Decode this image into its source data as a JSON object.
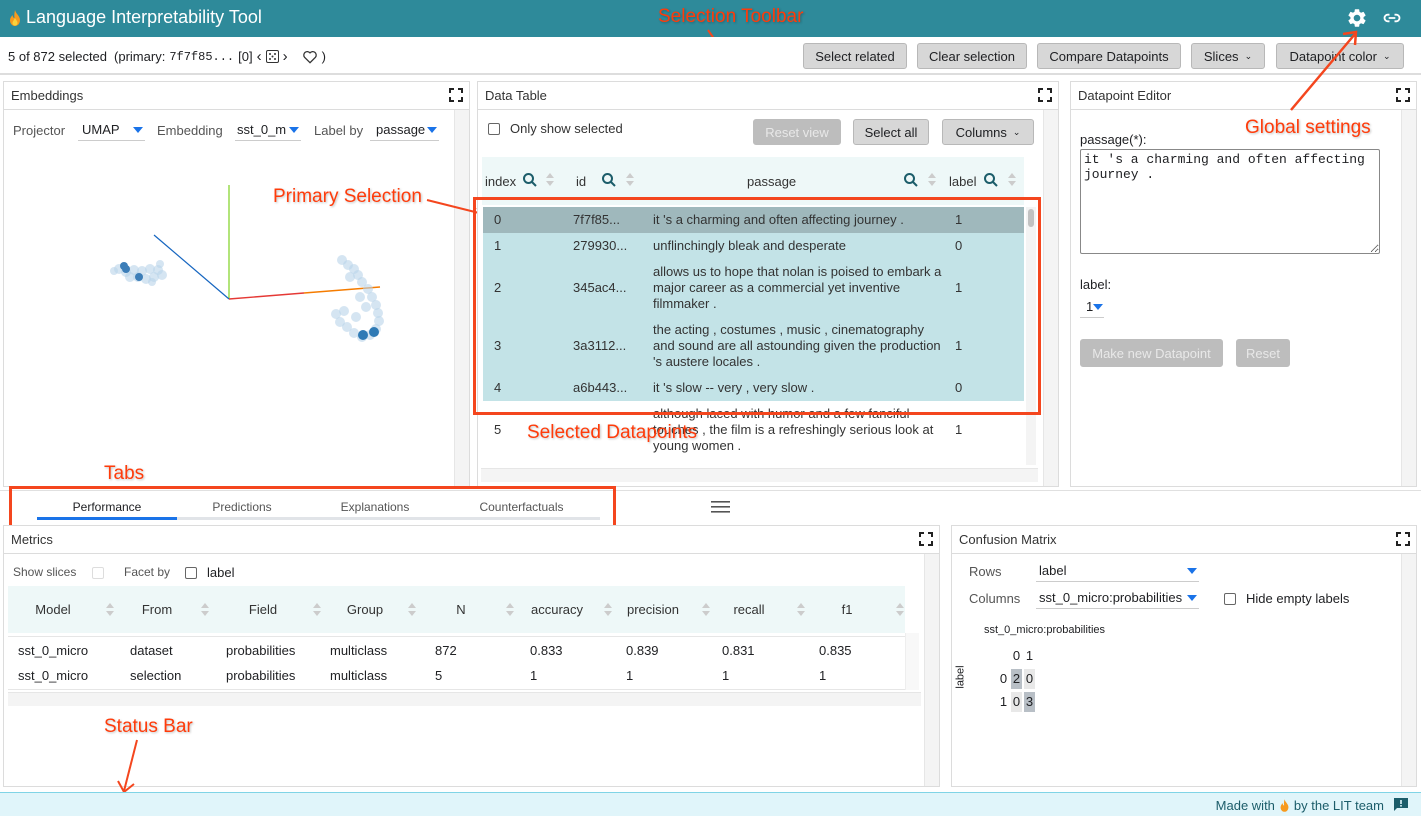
{
  "app": {
    "title": "Language Interpretability Tool",
    "icons": {
      "logo": "flame-icon",
      "settings": "gear-icon",
      "share": "link-icon"
    },
    "theme": {
      "header_bg": "#2e8a9a",
      "accent": "#1a73e8",
      "selected_row": "#c3e3e7",
      "primary_row": "#9fb8bc",
      "annotation": "#ff3b0a"
    }
  },
  "selection_toolbar": {
    "status_prefix": "5 of 872 selected",
    "primary_label": "(primary:",
    "primary_id": "7f7f85...",
    "primary_index": "[0]",
    "prev": "‹",
    "next": "›",
    "close_paren": ")",
    "buttons": {
      "select_related": "Select related",
      "clear_selection": "Clear selection",
      "compare": "Compare Datapoints",
      "slices": "Slices",
      "datapoint_color": "Datapoint color"
    }
  },
  "embeddings": {
    "title": "Embeddings",
    "projector_label": "Projector",
    "projector_value": "UMAP",
    "embedding_label": "Embedding",
    "embedding_value": "sst_0_m",
    "labelby_label": "Label by",
    "labelby_value": "passage"
  },
  "data_table": {
    "title": "Data Table",
    "only_show_selected": "Only show selected",
    "reset_view": "Reset view",
    "select_all": "Select all",
    "columns": "Columns",
    "headers": [
      "index",
      "id",
      "passage",
      "label"
    ],
    "rows": [
      {
        "index": "0",
        "id": "7f7f85...",
        "passage": "it 's a charming and often affecting journey .",
        "label": "1",
        "state": "primary"
      },
      {
        "index": "1",
        "id": "279930...",
        "passage": "unflinchingly bleak and desperate",
        "label": "0",
        "state": "selected"
      },
      {
        "index": "2",
        "id": "345ac4...",
        "passage": "allows us to hope that nolan is poised to embark a major career as a commercial yet inventive filmmaker .",
        "label": "1",
        "state": "selected"
      },
      {
        "index": "3",
        "id": "3a3112...",
        "passage": "the acting , costumes , music , cinematography and sound are all astounding given the production 's austere locales .",
        "label": "1",
        "state": "selected"
      },
      {
        "index": "4",
        "id": "a6b443...",
        "passage": "it 's slow -- very , very slow .",
        "label": "0",
        "state": "selected"
      },
      {
        "index": "5",
        "id": "",
        "passage": "although laced with humor and a few fanciful touches , the film is a refreshingly serious look at young women .",
        "label": "1",
        "state": "none"
      }
    ]
  },
  "datapoint_editor": {
    "title": "Datapoint Editor",
    "passage_label": "passage(*):",
    "passage_value": "it 's a charming and often affecting journey .",
    "label_label": "label:",
    "label_value": "1",
    "make_new": "Make new Datapoint",
    "reset": "Reset"
  },
  "tabs": {
    "items": [
      "Performance",
      "Predictions",
      "Explanations",
      "Counterfactuals"
    ],
    "active": "Performance",
    "menu_icon": "hamburger-icon"
  },
  "metrics": {
    "title": "Metrics",
    "show_slices": "Show slices",
    "facet_by": "Facet by",
    "facet_option": "label",
    "headers": [
      "Model",
      "From",
      "Field",
      "Group",
      "N",
      "accuracy",
      "precision",
      "recall",
      "f1"
    ],
    "rows": [
      [
        "sst_0_micro",
        "dataset",
        "probabilities",
        "multiclass",
        "872",
        "0.833",
        "0.839",
        "0.831",
        "0.835"
      ],
      [
        "sst_0_micro",
        "selection",
        "probabilities",
        "multiclass",
        "5",
        "1",
        "1",
        "1",
        "1"
      ]
    ]
  },
  "confusion_matrix": {
    "title": "Confusion Matrix",
    "rows_label": "Rows",
    "rows_value": "label",
    "columns_label": "Columns",
    "columns_value": "sst_0_micro:probabilities",
    "hide_empty": "Hide empty labels",
    "matrix_title": "sst_0_micro:probabilities",
    "row_axis": "label",
    "col_labels": [
      "0",
      "1"
    ],
    "row_labels": [
      "0",
      "1"
    ],
    "values": [
      [
        "2",
        "0"
      ],
      [
        "0",
        "3"
      ]
    ]
  },
  "footer": {
    "made_with": "Made with",
    "by": "by the LIT team",
    "feedback_icon": "feedback-icon"
  },
  "annotations": {
    "selection_toolbar": "Selection Toolbar",
    "primary_selection": "Primary Selection",
    "selected_datapoints": "Selected Datapoints",
    "global_settings": "Global settings",
    "tabs": "Tabs",
    "status_bar": "Status Bar"
  }
}
